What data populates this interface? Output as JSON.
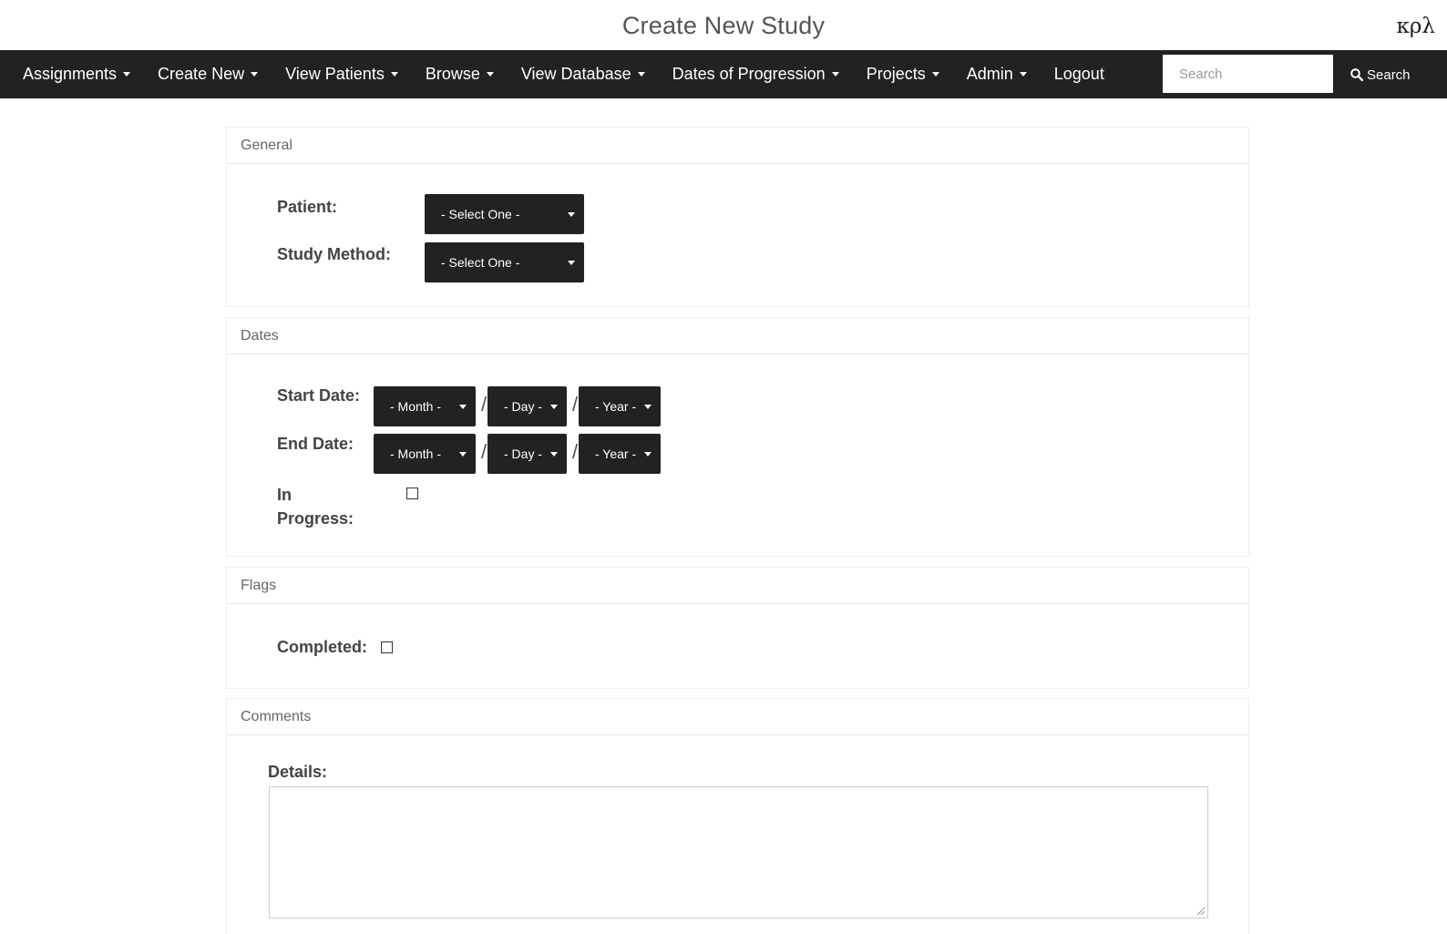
{
  "header": {
    "title": "Create New Study",
    "brand": "κρλ"
  },
  "nav": {
    "items": [
      {
        "label": "Assignments",
        "dropdown": true
      },
      {
        "label": "Create New",
        "dropdown": true
      },
      {
        "label": "View Patients",
        "dropdown": true
      },
      {
        "label": "Browse",
        "dropdown": true
      },
      {
        "label": "View Database",
        "dropdown": true
      },
      {
        "label": "Dates of Progression",
        "dropdown": true
      },
      {
        "label": "Projects",
        "dropdown": true
      },
      {
        "label": "Admin",
        "dropdown": true
      },
      {
        "label": "Logout",
        "dropdown": false
      }
    ],
    "search_placeholder": "Search",
    "search_button": "Search"
  },
  "sections": {
    "general": {
      "heading": "General",
      "patient_label": "Patient:",
      "patient_value": "- Select One -",
      "method_label": "Study Method:",
      "method_value": "- Select One -"
    },
    "dates": {
      "heading": "Dates",
      "start_label": "Start Date:",
      "end_label": "End Date:",
      "month": "- Month -",
      "day": "- Day -",
      "year": "- Year -",
      "separator": "/",
      "in_progress_line1": "In",
      "in_progress_line2": "Progress:"
    },
    "flags": {
      "heading": "Flags",
      "completed_label": "Completed:"
    },
    "comments": {
      "heading": "Comments",
      "details_label": "Details:",
      "details_value": ""
    }
  },
  "colors": {
    "navbar": "#222222",
    "button": "#222222"
  }
}
